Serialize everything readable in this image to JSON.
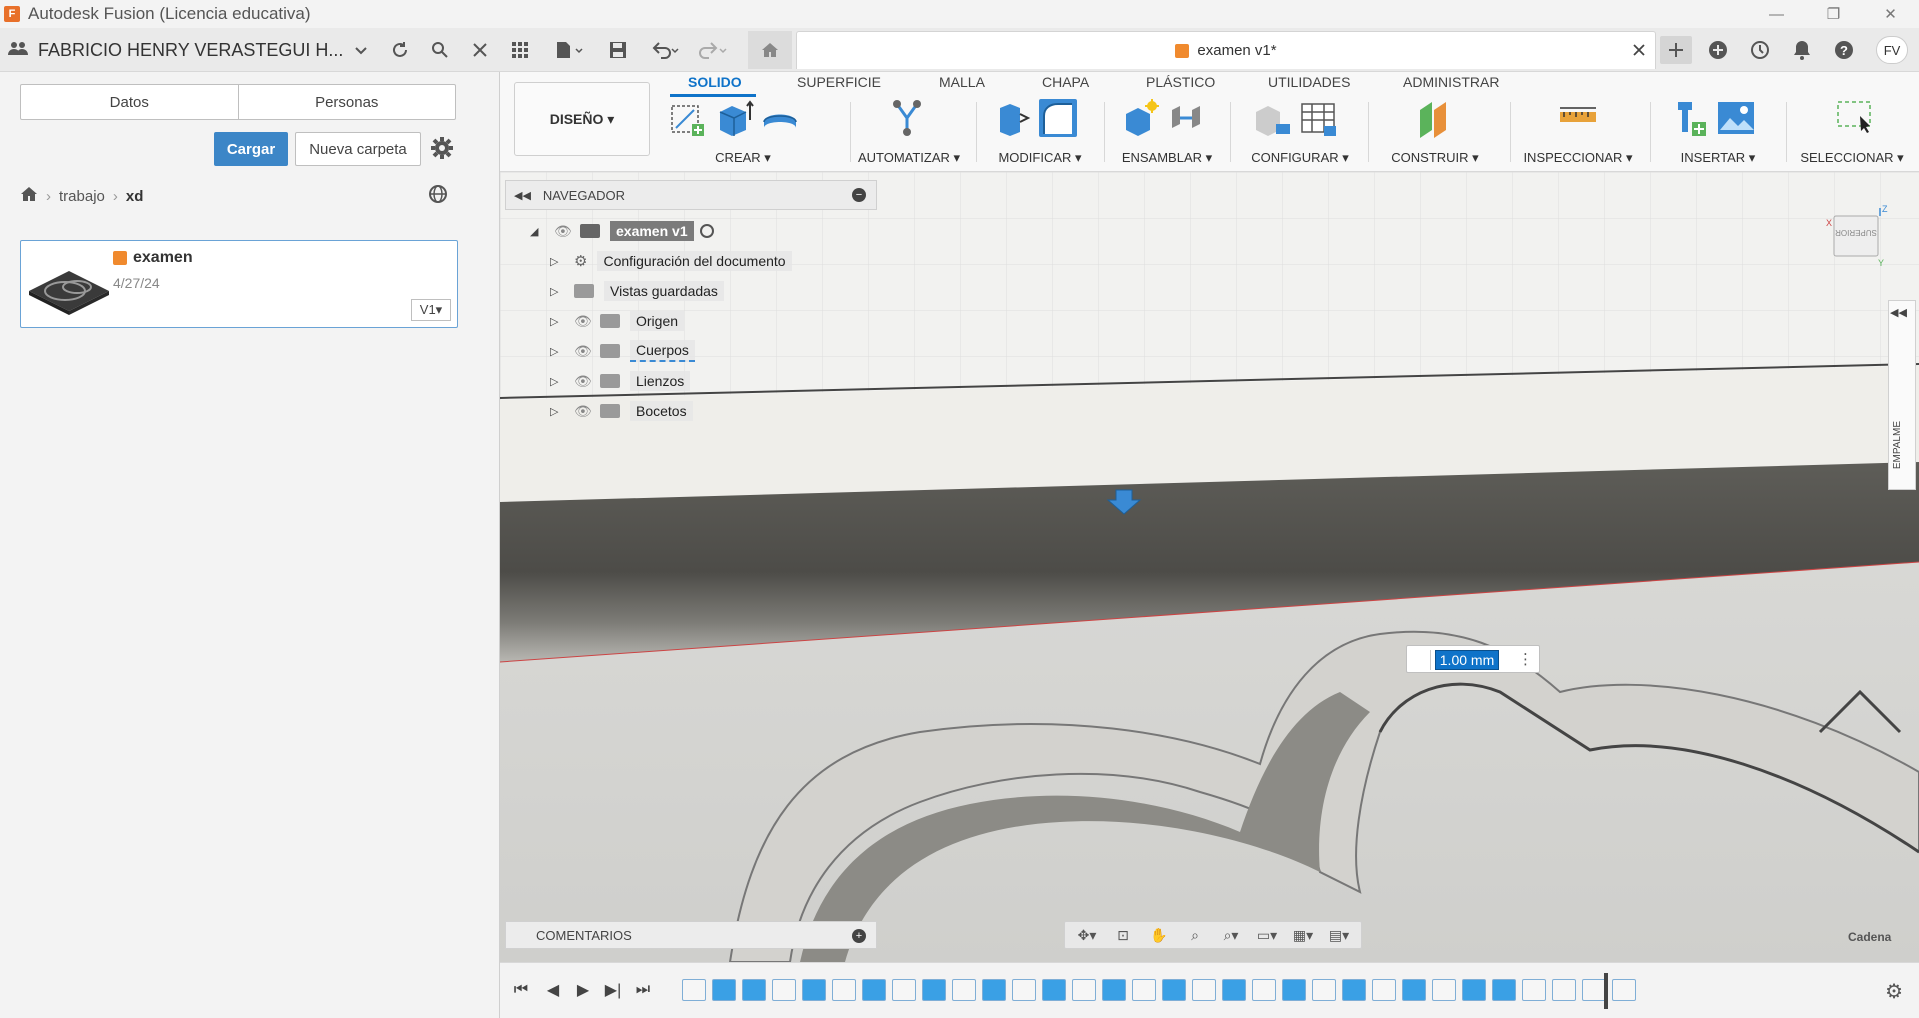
{
  "window": {
    "title": "Autodesk Fusion (Licencia educativa)",
    "logo_letter": "F",
    "controls": [
      "—",
      "❐",
      "✕"
    ]
  },
  "topbar": {
    "team_name": "FABRICIO HENRY VERASTEGUI H...",
    "document_tab": "examen v1*",
    "avatar_initials": "FV"
  },
  "left_panel": {
    "tabs": [
      "Datos",
      "Personas"
    ],
    "upload_label": "Cargar",
    "new_folder_label": "Nueva carpeta",
    "breadcrumb": [
      "trabajo",
      "xd"
    ],
    "file": {
      "name": "examen",
      "date": "4/27/24",
      "version": "V1▾"
    }
  },
  "ribbon": {
    "workspace": "DISEÑO ▾",
    "tabs": [
      "SOLIDO",
      "SUPERFICIE",
      "MALLA",
      "CHAPA",
      "PLÁSTICO",
      "UTILIDADES",
      "ADMINISTRAR"
    ],
    "active_tab": "SOLIDO",
    "groups": {
      "crear": "CREAR ▾",
      "automatizar": "AUTOMATIZAR ▾",
      "modificar": "MODIFICAR ▾",
      "ensamblar": "ENSAMBLAR ▾",
      "configurar": "CONFIGURAR ▾",
      "construir": "CONSTRUIR ▾",
      "inspeccionar": "INSPECCIONAR ▾",
      "insertar": "INSERTAR ▾",
      "seleccionar": "SELECCIONAR ▾"
    }
  },
  "navigator": {
    "title": "NAVEGADOR",
    "root": "examen v1",
    "items": [
      "Configuración del documento",
      "Vistas guardadas",
      "Origen",
      "Cuerpos",
      "Lienzos",
      "Bocetos"
    ]
  },
  "viewport": {
    "dimension_value": "1.00 mm",
    "viewcube_label": "SUPERIOR",
    "right_panel_label": "EMPALME",
    "chain_label": "Cadena",
    "comments_label": "COMENTARIOS"
  },
  "colors": {
    "accent": "#0f73c9",
    "upload_button": "#3c86c7",
    "brand_orange": "#e8702a"
  }
}
